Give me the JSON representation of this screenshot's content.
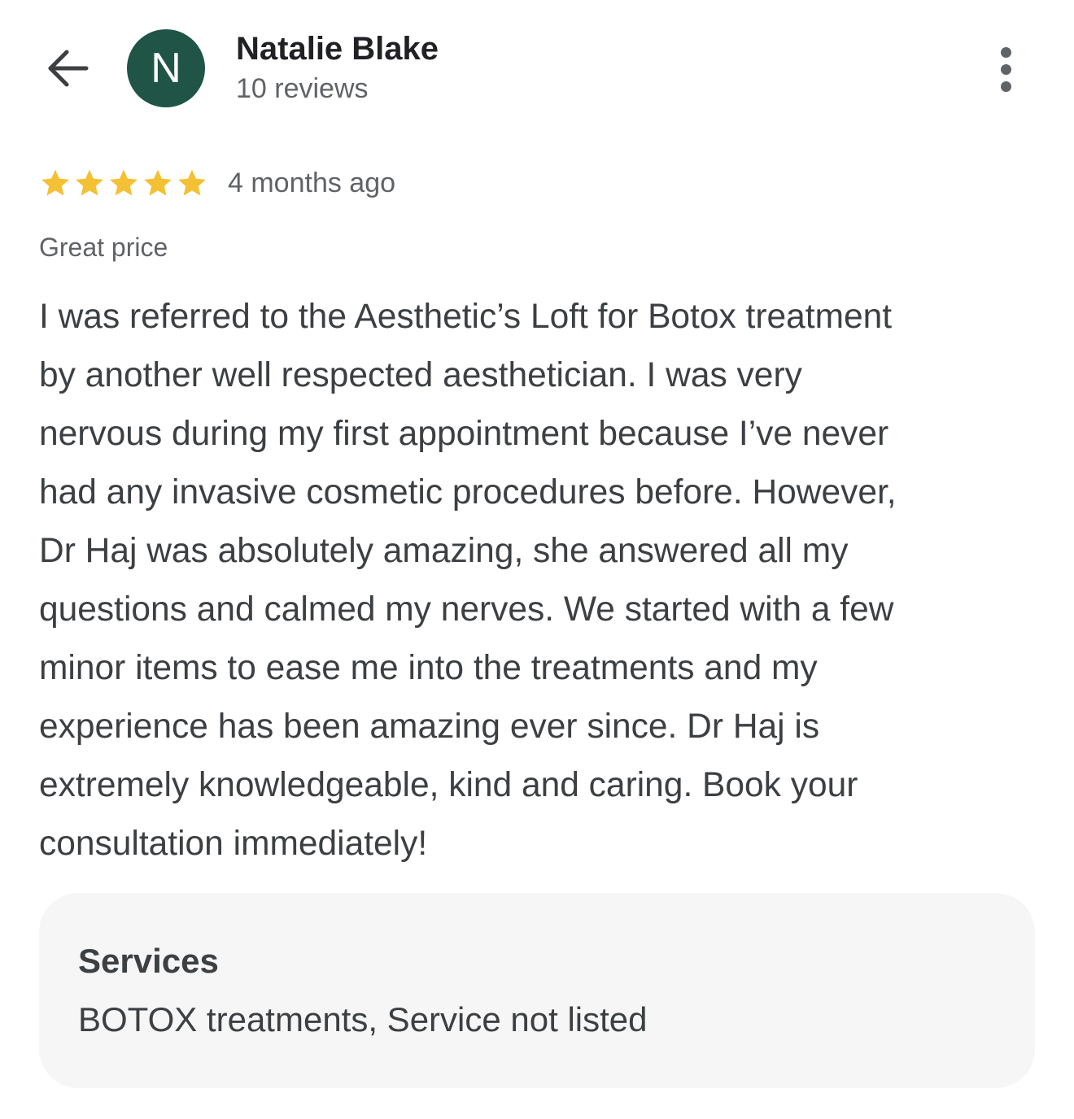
{
  "header": {
    "back_icon": "arrow-back-icon",
    "avatar_initial": "N",
    "avatar_color": "#1f5447",
    "author_name": "Natalie Blake",
    "review_count": "10 reviews",
    "more_icon": "more-vert-icon"
  },
  "review": {
    "rating": 5,
    "rating_max": 5,
    "star_color": "#f4c034",
    "time_ago": "4 months ago",
    "highlight": "Great price",
    "text_lines": [
      "I was referred to the Aesthetic’s Loft for Botox treatment",
      "by another well respected aesthetician. I was very",
      "nervous during my first appointment because I’ve never",
      "had any invasive cosmetic procedures before. However,",
      "Dr Haj was absolutely amazing, she answered all my",
      "questions and calmed my nerves. We started with a few",
      "minor items to ease me into the treatments and my",
      "experience has been amazing ever since. Dr Haj is",
      "extremely knowledgeable, kind and caring. Book your",
      "consultation immediately!"
    ]
  },
  "services": {
    "title": "Services",
    "list": "BOTOX treatments, Service not listed"
  }
}
